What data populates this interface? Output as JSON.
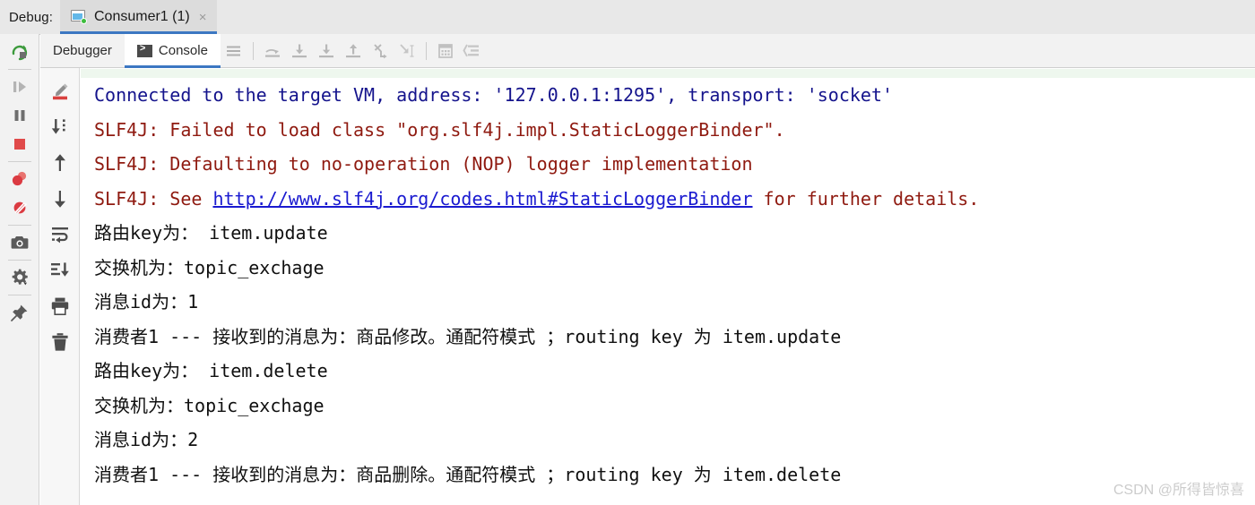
{
  "window": {
    "debug_label": "Debug:"
  },
  "tab": {
    "title": "Consumer1 (1)",
    "close_label": "×",
    "icon": "run-configuration-icon",
    "status_dot_color": "#3dbd3d",
    "underline_color": "#3c77c2"
  },
  "toolbar": {
    "tabs": [
      {
        "label": "Debugger",
        "icon": "debugger-icon",
        "selected": false
      },
      {
        "label": "Console",
        "icon": "console-icon",
        "selected": true
      }
    ],
    "icons": [
      {
        "name": "show-options-menu-icon"
      },
      {
        "name": "step-over-icon"
      },
      {
        "name": "step-into-icon"
      },
      {
        "name": "force-step-into-icon"
      },
      {
        "name": "step-out-icon"
      },
      {
        "name": "drop-frame-icon"
      },
      {
        "name": "run-to-cursor-icon"
      },
      {
        "name": "evaluate-expression-icon"
      },
      {
        "name": "sort-threads-icon"
      }
    ]
  },
  "left_strip": {
    "icons": [
      {
        "name": "rerun-icon",
        "color": "#3c9a3c"
      },
      {
        "name": "resume-program-icon",
        "color": "#9a9a9a"
      },
      {
        "name": "pause-program-icon",
        "color": "#6e6e6e"
      },
      {
        "name": "stop-icon",
        "color": "#e04a4a"
      },
      {
        "name": "view-breakpoints-icon",
        "color": "#db3b42"
      },
      {
        "name": "mute-breakpoints-icon",
        "color": "#db3b42"
      },
      {
        "name": "screenshot-icon",
        "color": "#5a5a5a"
      },
      {
        "name": "settings-gear-icon",
        "color": "#5a5a5a"
      },
      {
        "name": "pin-tab-icon",
        "color": "#5a5a5a"
      }
    ]
  },
  "console_strip": {
    "icons": [
      {
        "name": "highlight-pen-icon",
        "color": "#d9413f"
      },
      {
        "name": "scroll-to-end-icon",
        "color": "#4d4d4d"
      },
      {
        "name": "previous-occurrence-icon",
        "color": "#4d4d4d"
      },
      {
        "name": "next-occurrence-icon",
        "color": "#4d4d4d"
      },
      {
        "name": "soft-wrap-icon",
        "color": "#4d4d4d"
      },
      {
        "name": "scroll-to-the-end-icon",
        "color": "#4d4d4d"
      },
      {
        "name": "print-icon",
        "color": "#4d4d4d"
      },
      {
        "name": "clear-all-icon",
        "color": "#4d4d4d"
      }
    ]
  },
  "console": {
    "clipped_top_line": "",
    "lines": [
      {
        "id": "line-connected",
        "style": "blue",
        "text": "Connected to the target VM, address: '127.0.0.1:1295', transport: 'socket'"
      },
      {
        "id": "line-slf4j-failed",
        "style": "red",
        "text": "SLF4J: Failed to load class \"org.slf4j.impl.StaticLoggerBinder\"."
      },
      {
        "id": "line-slf4j-defaulting",
        "style": "red",
        "text": "SLF4J: Defaulting to no-operation (NOP) logger implementation"
      },
      {
        "id": "line-slf4j-see",
        "style": "red",
        "prefix": "SLF4J: See ",
        "link": "http://www.slf4j.org/codes.html#StaticLoggerBinder",
        "suffix": " for further details."
      },
      {
        "id": "line-routing-key-1",
        "style": "black",
        "text": "路由key为： item.update"
      },
      {
        "id": "line-exchange-1",
        "style": "black",
        "text": "交换机为：topic_exchage"
      },
      {
        "id": "line-msgid-1",
        "style": "black",
        "text": "消息id为：1"
      },
      {
        "id": "line-consumer-1",
        "style": "black",
        "text": "消费者1 --- 接收到的消息为：商品修改。通配符模式 ；routing key 为 item.update"
      },
      {
        "id": "line-routing-key-2",
        "style": "black",
        "text": "路由key为： item.delete"
      },
      {
        "id": "line-exchange-2",
        "style": "black",
        "text": "交换机为：topic_exchage"
      },
      {
        "id": "line-msgid-2",
        "style": "black",
        "text": "消息id为：2"
      },
      {
        "id": "line-consumer-2",
        "style": "black",
        "text": "消费者1 --- 接收到的消息为：商品删除。通配符模式 ；routing key 为 item.delete"
      }
    ]
  },
  "watermark": {
    "text": "CSDN @所得皆惊喜"
  }
}
